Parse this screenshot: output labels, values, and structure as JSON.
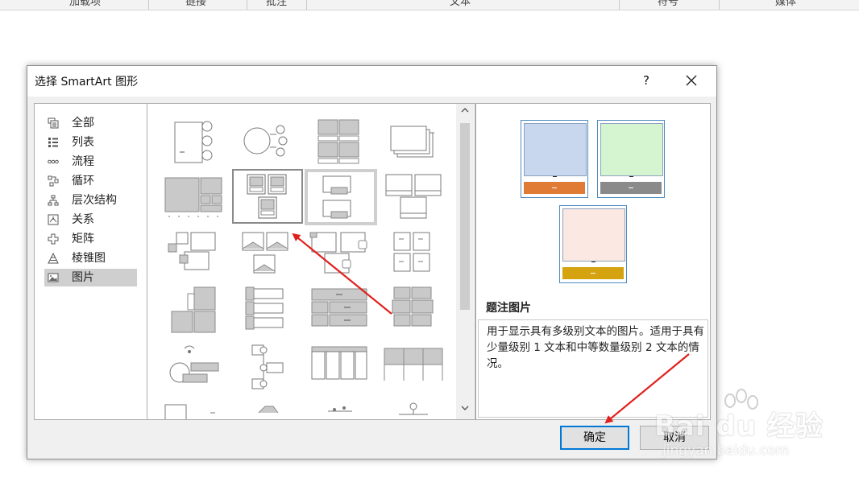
{
  "ribbon": {
    "groups": [
      "加载项",
      "链接",
      "批注",
      "文本",
      "符号",
      "媒体"
    ]
  },
  "dialog": {
    "title": "选择 SmartArt 图形",
    "help": "?",
    "categories": [
      {
        "label": "全部",
        "icon": "all-icon"
      },
      {
        "label": "列表",
        "icon": "list-icon"
      },
      {
        "label": "流程",
        "icon": "process-icon"
      },
      {
        "label": "循环",
        "icon": "cycle-icon"
      },
      {
        "label": "层次结构",
        "icon": "hierarchy-icon"
      },
      {
        "label": "关系",
        "icon": "relationship-icon"
      },
      {
        "label": "矩阵",
        "icon": "matrix-icon"
      },
      {
        "label": "棱锥图",
        "icon": "pyramid-icon"
      },
      {
        "label": "图片",
        "icon": "picture-icon"
      }
    ],
    "selected_category": "图片",
    "preview": {
      "title": "题注图片",
      "description": "用于显示具有多级别文本的图片。适用于具有少量级别 1 文本和中等数量级别 2 文本的情况。",
      "card_colors": [
        {
          "pic": "#c8d6ee",
          "bar": "#e07b35"
        },
        {
          "pic": "#d4f5d0",
          "bar": "#8a8a8a"
        },
        {
          "pic": "#fbe8e2",
          "bar": "#d4a30f"
        }
      ]
    },
    "ok_label": "确定",
    "cancel_label": "取消"
  },
  "watermark": {
    "brand": "Bai du 经验",
    "url": "jingyan.baidu.com"
  },
  "colors": {
    "accent": "#0078d7",
    "annotation_arrow": "#e0201d"
  }
}
